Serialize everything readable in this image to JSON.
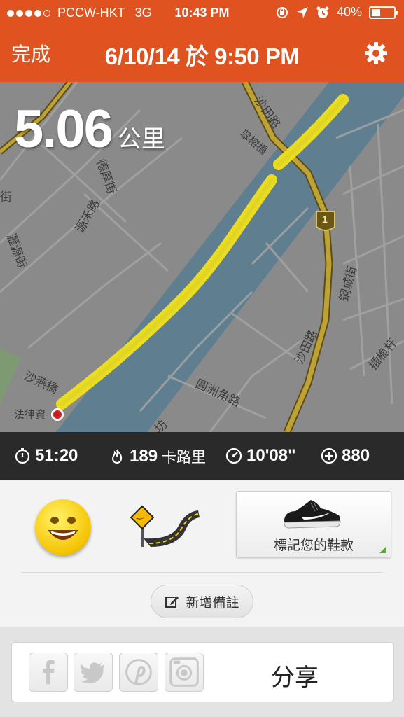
{
  "status_bar": {
    "carrier": "PCCW-HKT",
    "network": "3G",
    "time": "10:43 PM",
    "battery": "40%",
    "battery_level": 0.4,
    "icons": [
      "rotation-lock-icon",
      "location-arrow-icon",
      "alarm-icon",
      "battery-icon"
    ]
  },
  "nav": {
    "done_label": "完成",
    "title": "6/10/14 於 9:50 PM",
    "settings_icon": "gear-icon"
  },
  "map": {
    "distance_value": "5.06",
    "distance_unit": "公里",
    "route_color": "#f2e21a",
    "water_color": "#5f7f90",
    "labels": {
      "road_shatin": "沙田路",
      "road_tak_hau": "德厚街",
      "road_yuen_wo": "源禾路",
      "road_tsui_lok": "翠榕橋",
      "road_lo_yuen": "瀝源街",
      "road_sha_yin": "沙燕橋",
      "law_building": "法律資",
      "road_shatin_2": "沙田路",
      "road_kwong_sin": "鋼城街",
      "road_yuen_chau": "圓洲角路",
      "road_chap_wai": "插桅杆",
      "route_marker": "1",
      "partial_label": "坊",
      "partial_left": "街"
    }
  },
  "stats": {
    "duration": "51:20",
    "calories_value": "189",
    "calories_unit": "卡路里",
    "pace": "10'08\"",
    "fuel": "880"
  },
  "feeling": {
    "emoji_icon": "grinning-face-icon",
    "terrain_icon": "road-sign-icon",
    "shoe_label": "標記您的鞋款",
    "note_label": "新增備註"
  },
  "share": {
    "label": "分享",
    "icons": [
      "facebook-icon",
      "twitter-icon",
      "pinterest-icon",
      "instagram-icon"
    ]
  }
}
